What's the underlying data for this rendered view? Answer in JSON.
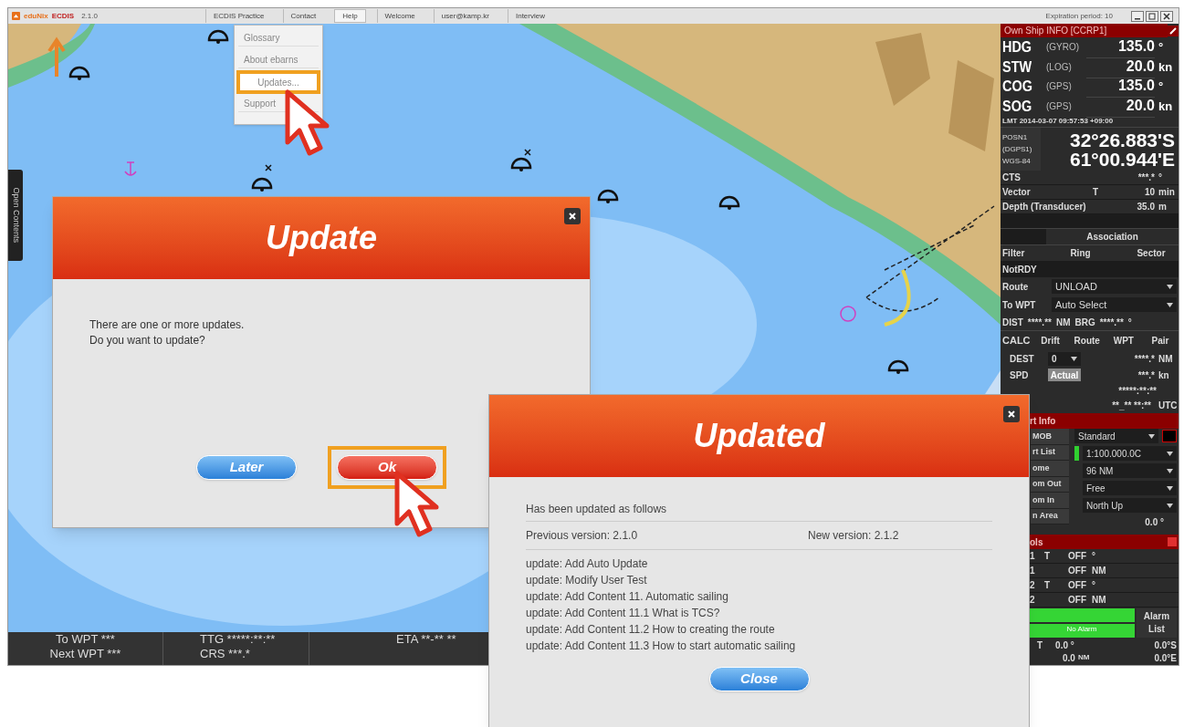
{
  "app": {
    "logo": "eduNix",
    "product": "ECDIS",
    "version": "2.1.0",
    "expiration": "Expiration period: 10",
    "menu": [
      {
        "label": "ECDIS Practice",
        "selected": false
      },
      {
        "label": "Contact",
        "selected": false
      },
      {
        "label": "Help",
        "selected": true
      },
      {
        "label": "Welcome",
        "selected": false
      },
      {
        "label": "user@kamp.kr",
        "selected": false
      },
      {
        "label": "Interview",
        "selected": false
      }
    ]
  },
  "help_menu": [
    {
      "label": "Glossary",
      "selected": false
    },
    {
      "label": "About ebarns",
      "selected": false
    },
    {
      "label": "Updates...",
      "selected": true
    },
    {
      "label": "Support",
      "selected": false
    }
  ],
  "side_tab": "Open Contents",
  "status_bar": {
    "to_wpt": "To WPT ***",
    "next_wpt": "Next WPT ***",
    "ttg": "TTG *****:**:**",
    "crs": "CRS ***.*",
    "eta": "ETA **-** **"
  },
  "own_ship": {
    "title": "Own Ship INFO [CCRP1]",
    "readings": [
      {
        "name": "HDG",
        "source": "(GYRO)",
        "value": "135.0",
        "unit": "°"
      },
      {
        "name": "STW",
        "source": "(LOG)",
        "value": "20.0",
        "unit": "kn"
      },
      {
        "name": "COG",
        "source": "(GPS)",
        "value": "135.0",
        "unit": "°"
      },
      {
        "name": "SOG",
        "source": "(GPS)",
        "value": "20.0",
        "unit": "kn"
      }
    ],
    "lmt": "LMT 2014-03-07 09:57:53 +09:00",
    "position": {
      "labels": [
        "POSN1",
        "(DGPS1)",
        "WGS-84"
      ],
      "lat": "32°26.883'S",
      "lon": "61°00.944'E"
    },
    "rows": [
      {
        "label": "CTS",
        "mode": "",
        "value": "***.*",
        "unit": "°"
      },
      {
        "label": "Vector",
        "mode": "T",
        "value": "10",
        "unit": "min"
      },
      {
        "label": "Depth (Transducer)",
        "mode": "",
        "value": "35.0",
        "unit": "m"
      }
    ],
    "target": {
      "association": "Association",
      "filter": "Filter",
      "ring": "Ring",
      "sector": "Sector",
      "status": "NotRDY"
    },
    "route": {
      "route_label": "Route",
      "route_value": "UNLOAD",
      "wpt_label": "To WPT",
      "wpt_value": "Auto Select",
      "dist_label": "DIST",
      "dist_value": "****.**",
      "dist_unit": "NM",
      "brg_label": "BRG",
      "brg_value": "****.**",
      "brg_unit": "°"
    },
    "calc": {
      "label": "CALC",
      "tabs": [
        "Drift",
        "Route",
        "WPT",
        "Pair"
      ]
    },
    "dest": {
      "label": "DEST",
      "select": "0",
      "value": "****.*",
      "unit": "NM"
    },
    "spd": {
      "label": "SPD",
      "mode": "Actual",
      "value": "***.*",
      "unit": "kn"
    },
    "ttg": {
      "value": "*****:**:**"
    },
    "eta": {
      "value": "**_** **:**",
      "unit": "UTC"
    }
  },
  "chart_info": {
    "title": "rt Info",
    "buttons": [
      "MOB",
      "rt List",
      "ome",
      "om Out",
      "om In",
      "n Area"
    ],
    "display": "Standard",
    "scale": "1:100.000.0C",
    "range": "96 NM",
    "motion": "Free",
    "orientation": "North Up",
    "angle": "0.0 °"
  },
  "tools": {
    "title": "ols",
    "rows": [
      [
        "1",
        "T",
        "OFF",
        "°"
      ],
      [
        "1",
        "",
        "OFF",
        "NM"
      ],
      [
        "2",
        "T",
        "OFF",
        "°"
      ],
      [
        "2",
        "",
        "OFF",
        "NM"
      ]
    ]
  },
  "alarm": {
    "status": "No Alarm",
    "button": "Alarm List"
  },
  "cursor": {
    "mode": "T",
    "bearing": "0.0 °",
    "range": "0.0",
    "range_unit": "NM",
    "lat": "0.0°S",
    "lon": "0.0°E"
  },
  "update_dialog": {
    "title": "Update",
    "message_lines": [
      "There are one or more updates.",
      "Do you want to update?"
    ],
    "buttons": [
      {
        "label": "Later",
        "kind": "secondary",
        "highlighted": false
      },
      {
        "label": "Ok",
        "kind": "primary",
        "highlighted": true
      }
    ]
  },
  "updated_dialog": {
    "title": "Updated",
    "intro": "Has been updated as follows",
    "previous": "Previous version:  2.1.0",
    "new": "New version:  2.1.2",
    "changes": [
      "update: Add Auto Update",
      "update: Modify User Test",
      "update: Add Content 11. Automatic sailing",
      "update: Add Content 11.1 What is TCS?",
      "update: Add Content 11.2 How to creating the route",
      "update: Add Content 11.3 How to start automatic sailing"
    ],
    "button": "Close"
  }
}
